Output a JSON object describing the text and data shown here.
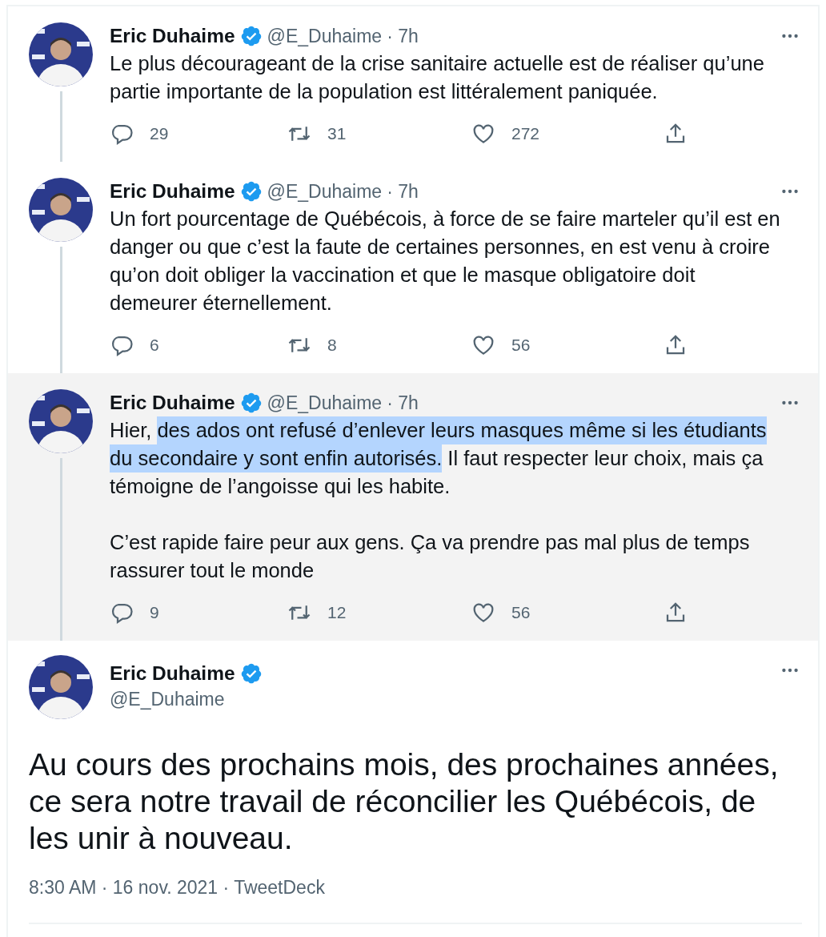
{
  "thread": [
    {
      "name": "Eric Duhaime",
      "verified": true,
      "handle": "@E_Duhaime",
      "time": "· 7h",
      "hovered": false,
      "paragraphs": [
        [
          [
            {
              "text": "Le plus décourageant de la crise sanitaire actuelle est de réaliser qu’une",
              "highlighted": false
            }
          ],
          [
            {
              "text": "partie importante de la population est littéralement paniquée.",
              "highlighted": false
            }
          ]
        ]
      ],
      "replies": "29",
      "retweets": "31",
      "likes": "272"
    },
    {
      "name": "Eric Duhaime",
      "verified": true,
      "handle": "@E_Duhaime",
      "time": "· 7h",
      "hovered": false,
      "paragraphs": [
        [
          [
            {
              "text": "Un fort pourcentage de Québécois, à force de se faire marteler qu’il est en",
              "highlighted": false
            }
          ],
          [
            {
              "text": "danger ou que c’est la faute de certaines personnes, en est venu à croire",
              "highlighted": false
            }
          ],
          [
            {
              "text": "qu’on doit obliger la vaccination et que le masque obligatoire doit",
              "highlighted": false
            }
          ],
          [
            {
              "text": "demeurer éternellement.",
              "highlighted": false
            }
          ]
        ]
      ],
      "replies": "6",
      "retweets": "8",
      "likes": "56"
    },
    {
      "name": "Eric Duhaime",
      "verified": true,
      "handle": "@E_Duhaime",
      "time": "· 7h",
      "hovered": true,
      "paragraphs": [
        [
          [
            {
              "text": "Hier,",
              "highlighted": false
            },
            {
              "text": "des ados ont refusé d’enlever leurs masques même si les étudiants",
              "highlighted": true
            }
          ],
          [
            {
              "text": "du secondaire y sont enfin autorisés.",
              "highlighted": true
            },
            {
              "text": "Il faut respecter leur choix, mais ça",
              "highlighted": false
            }
          ],
          [
            {
              "text": "témoigne de l’angoisse qui les habite.",
              "highlighted": false
            }
          ]
        ],
        [
          [
            {
              "text": "C’est rapide faire peur aux gens. Ça va prendre pas mal plus de temps",
              "highlighted": false
            }
          ],
          [
            {
              "text": "rassurer tout le monde",
              "highlighted": false
            }
          ]
        ]
      ],
      "replies": "9",
      "retweets": "12",
      "likes": "56"
    }
  ],
  "main_tweet": {
    "name": "Eric Duhaime",
    "verified": true,
    "handle": "@E_Duhaime",
    "lines": [
      "Au cours des prochains mois, des prochaines années,",
      "ce sera notre travail de réconcilier les Québécois, de",
      "les unir à nouveau."
    ],
    "meta": "8:30 AM · 16 nov. 2021 · TweetDeck"
  }
}
